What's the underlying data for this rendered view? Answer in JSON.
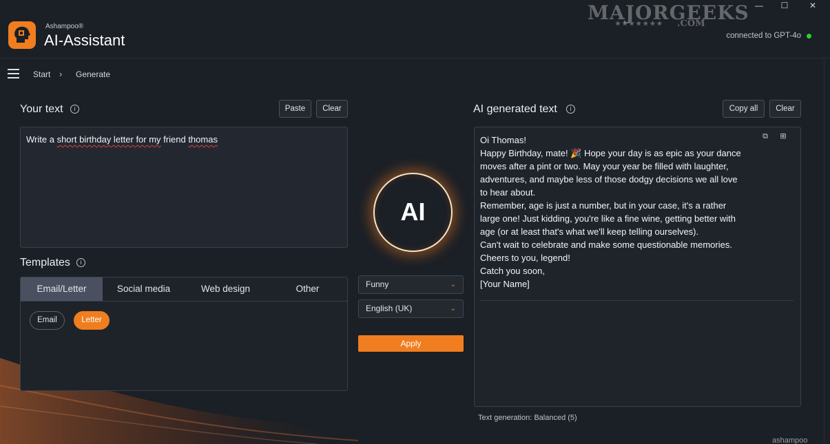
{
  "window": {
    "minimize_glyph": "—",
    "maximize_glyph": "☐",
    "close_glyph": "✕"
  },
  "watermark": {
    "main": "MAJORGEEKS",
    "stars": "★★★★★★★",
    "sub": ".COM"
  },
  "header": {
    "brand_small": "Ashampoo®",
    "app_title": "AI-Assistant",
    "connection_status": "connected to GPT-4o",
    "status_color": "#2ed12e"
  },
  "nav": {
    "breadcrumb_start": "Start",
    "breadcrumb_separator": "›",
    "breadcrumb_current": "Generate"
  },
  "input_panel": {
    "title": "Your text",
    "paste_label": "Paste",
    "clear_label": "Clear",
    "text_plain_1": "Write a ",
    "text_spell_1": "short birthday letter for my",
    "text_plain_2": " friend ",
    "text_spell_2": "thomas"
  },
  "templates": {
    "title": "Templates",
    "tabs": [
      {
        "label": "Email/Letter",
        "active": true
      },
      {
        "label": "Social media",
        "active": false
      },
      {
        "label": "Web design",
        "active": false
      },
      {
        "label": "Other",
        "active": false
      }
    ],
    "chips": [
      {
        "label": "Email",
        "selected": false
      },
      {
        "label": "Letter",
        "selected": true
      }
    ]
  },
  "center": {
    "ai_label": "AI",
    "tone_value": "Funny",
    "language_value": "English (UK)",
    "apply_label": "Apply"
  },
  "output_panel": {
    "title": "AI generated text",
    "copy_all_label": "Copy all",
    "clear_label": "Clear",
    "lines": [
      "Oi Thomas!",
      "Happy Birthday, mate! 🎉 Hope your day is as epic as your dance",
      "moves after a pint or two. May your year be filled with laughter,",
      "adventures, and maybe less of those dodgy decisions we all love",
      "to hear about.",
      "Remember, age is just a number, but in your case, it's a rather",
      "large one! Just kidding, you're like a fine wine, getting better with",
      "age (or at least that's what we'll keep telling ourselves).",
      "Can't wait to celebrate and make some questionable memories.",
      "Cheers to you, legend!",
      "Catch you soon,",
      "[Your Name]"
    ],
    "generation_note": "Text generation:  Balanced (5)"
  },
  "footer": {
    "brand": "ashampoo"
  },
  "colors": {
    "accent": "#f07d1f",
    "background": "#1b1f26"
  },
  "icons": {
    "info": "i",
    "chevron": "⌄",
    "copy": "⧉",
    "tree": "⊞"
  }
}
